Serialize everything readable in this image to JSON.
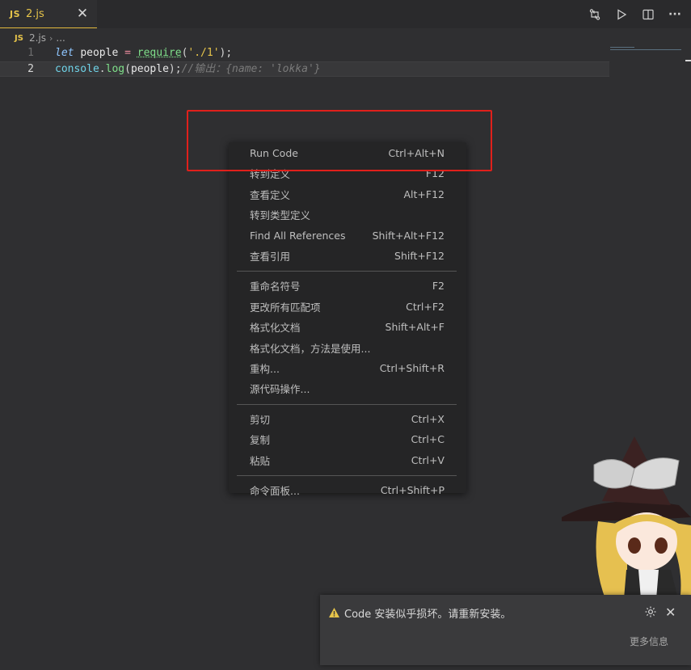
{
  "tab": {
    "icon_text": "JS",
    "filename": "2.js",
    "close_glyph": "✕"
  },
  "actions": [
    {
      "icon": "compare-changes-icon"
    },
    {
      "icon": "run-icon"
    },
    {
      "icon": "split-editor-icon"
    },
    {
      "icon": "more-actions-icon",
      "glyph": "···"
    }
  ],
  "breadcrumb": {
    "icon_text": "JS",
    "file": "2.js",
    "sep": "›",
    "rest": "..."
  },
  "editor": {
    "lines": [
      {
        "number": "1",
        "tokens": [
          {
            "t": "let",
            "c": "kw"
          },
          {
            "t": " ",
            "c": "var"
          },
          {
            "t": "people",
            "c": "var"
          },
          {
            "t": " = ",
            "c": "op"
          },
          {
            "t": "require",
            "c": "fn fn-under"
          },
          {
            "t": "(",
            "c": "punc"
          },
          {
            "t": "'./1'",
            "c": "str"
          },
          {
            "t": ");",
            "c": "punc"
          }
        ]
      },
      {
        "number": "2",
        "tokens": [
          {
            "t": "console",
            "c": "obj"
          },
          {
            "t": ".",
            "c": "punc"
          },
          {
            "t": "log",
            "c": "fn"
          },
          {
            "t": "(",
            "c": "punc"
          },
          {
            "t": "people",
            "c": "var"
          },
          {
            "t": ");",
            "c": "punc"
          },
          {
            "t": "//输出：{name: 'lokka'}",
            "c": "cmt"
          }
        ]
      }
    ]
  },
  "context_menu": {
    "groups": [
      [
        {
          "label": "Run Code",
          "key": "Ctrl+Alt+N"
        },
        {
          "label": "转到定义",
          "key": "F12"
        },
        {
          "label": "查看定义",
          "key": "Alt+F12"
        },
        {
          "label": "转到类型定义",
          "key": ""
        },
        {
          "label": "Find All References",
          "key": "Shift+Alt+F12"
        },
        {
          "label": "查看引用",
          "key": "Shift+F12"
        }
      ],
      [
        {
          "label": "重命名符号",
          "key": "F2"
        },
        {
          "label": "更改所有匹配项",
          "key": "Ctrl+F2"
        },
        {
          "label": "格式化文档",
          "key": "Shift+Alt+F"
        },
        {
          "label": "格式化文档，方法是使用...",
          "key": ""
        },
        {
          "label": "重构...",
          "key": "Ctrl+Shift+R"
        },
        {
          "label": "源代码操作...",
          "key": ""
        }
      ],
      [
        {
          "label": "剪切",
          "key": "Ctrl+X"
        },
        {
          "label": "复制",
          "key": "Ctrl+C"
        },
        {
          "label": "粘贴",
          "key": "Ctrl+V"
        }
      ],
      [
        {
          "label": "命令面板...",
          "key": "Ctrl+Shift+P"
        }
      ]
    ]
  },
  "notification": {
    "icon": "warning-icon",
    "message": "Code 安装似乎损坏。请重新安装。",
    "more": "更多信息",
    "close_glyph": "✕"
  },
  "colors": {
    "accent": "#e6c44a",
    "highlight_border": "#e0201b",
    "menu_bg": "#252526",
    "editor_bg": "#2f2f31"
  }
}
